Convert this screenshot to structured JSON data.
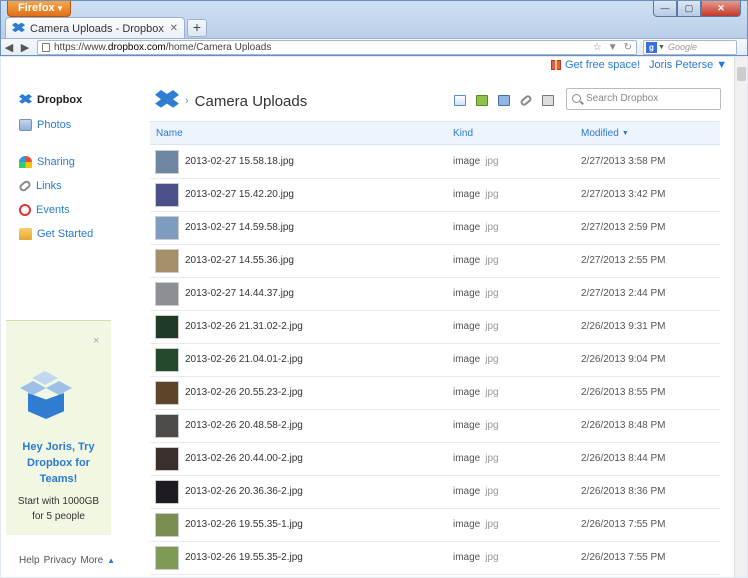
{
  "browser": {
    "menu_label": "Firefox",
    "tab_title": "Camera Uploads - Dropbox",
    "url_prefix": "https://www.",
    "url_host": "dropbox.com",
    "url_path": "/home/Camera Uploads",
    "search_engine_letter": "g",
    "search_placeholder": "Google"
  },
  "top": {
    "free_space": "Get free space!",
    "user": "Joris Peterse ▼"
  },
  "sidebar": {
    "items": [
      {
        "label": "Dropbox",
        "icon": "dropbox-icon"
      },
      {
        "label": "Photos",
        "icon": "photos-icon"
      },
      {
        "label": "Sharing",
        "icon": "sharing-icon"
      },
      {
        "label": "Links",
        "icon": "links-icon"
      },
      {
        "label": "Events",
        "icon": "events-icon"
      },
      {
        "label": "Get Started",
        "icon": "get-started-icon"
      }
    ],
    "promo": {
      "close": "×",
      "title": "Hey Joris, Try Dropbox for Teams!",
      "text": "Start with 1000GB for 5 people"
    },
    "footer": {
      "help": "Help",
      "privacy": "Privacy",
      "more": "More"
    }
  },
  "main": {
    "breadcrumb_sep": "›",
    "folder_title": "Camera Uploads",
    "search_placeholder": "Search Dropbox",
    "columns": {
      "name": "Name",
      "kind": "Kind",
      "modified": "Modified"
    },
    "files": [
      {
        "name": "2013-02-27 15.58.18.jpg",
        "kind": "image",
        "ext": "jpg",
        "modified": "2/27/2013 3:58 PM",
        "thumb": "#6f86a3"
      },
      {
        "name": "2013-02-27 15.42.20.jpg",
        "kind": "image",
        "ext": "jpg",
        "modified": "2/27/2013 3:42 PM",
        "thumb": "#4b4f8a"
      },
      {
        "name": "2013-02-27 14.59.58.jpg",
        "kind": "image",
        "ext": "jpg",
        "modified": "2/27/2013 2:59 PM",
        "thumb": "#7d9cbf"
      },
      {
        "name": "2013-02-27 14.55.36.jpg",
        "kind": "image",
        "ext": "jpg",
        "modified": "2/27/2013 2:55 PM",
        "thumb": "#a58f68"
      },
      {
        "name": "2013-02-27 14.44.37.jpg",
        "kind": "image",
        "ext": "jpg",
        "modified": "2/27/2013 2:44 PM",
        "thumb": "#8c8f94"
      },
      {
        "name": "2013-02-26 21.31.02-2.jpg",
        "kind": "image",
        "ext": "jpg",
        "modified": "2/26/2013 9:31 PM",
        "thumb": "#1f3a25"
      },
      {
        "name": "2013-02-26 21.04.01-2.jpg",
        "kind": "image",
        "ext": "jpg",
        "modified": "2/26/2013 9:04 PM",
        "thumb": "#234a2c"
      },
      {
        "name": "2013-02-26 20.55.23-2.jpg",
        "kind": "image",
        "ext": "jpg",
        "modified": "2/26/2013 8:55 PM",
        "thumb": "#5e4429"
      },
      {
        "name": "2013-02-26 20.48.58-2.jpg",
        "kind": "image",
        "ext": "jpg",
        "modified": "2/26/2013 8:48 PM",
        "thumb": "#4e4a47"
      },
      {
        "name": "2013-02-26 20.44.00-2.jpg",
        "kind": "image",
        "ext": "jpg",
        "modified": "2/26/2013 8:44 PM",
        "thumb": "#3a2f2a"
      },
      {
        "name": "2013-02-26 20.36.36-2.jpg",
        "kind": "image",
        "ext": "jpg",
        "modified": "2/26/2013 8:36 PM",
        "thumb": "#1e1c22"
      },
      {
        "name": "2013-02-26 19.55.35-1.jpg",
        "kind": "image",
        "ext": "jpg",
        "modified": "2/26/2013 7:55 PM",
        "thumb": "#7a8f4f"
      },
      {
        "name": "2013-02-26 19.55.35-2.jpg",
        "kind": "image",
        "ext": "jpg",
        "modified": "2/26/2013 7:55 PM",
        "thumb": "#7f9a55"
      }
    ]
  }
}
